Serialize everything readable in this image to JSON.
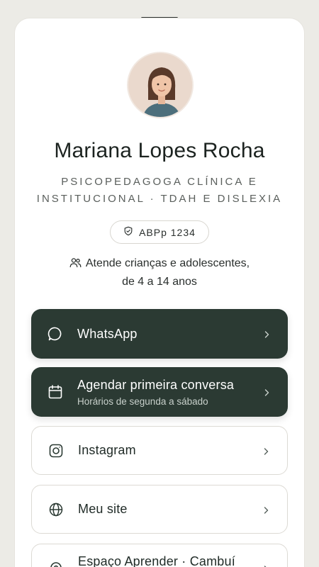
{
  "profile": {
    "name": "Mariana Lopes Rocha",
    "subtitle": "PSICOPEDAGOGA CLÍNICA E INSTITUCIONAL · TDAH E DISLEXIA",
    "badge": "ABPp 1234",
    "audience": "Atende crianças e adolescentes, de 4 a 14 anos"
  },
  "links": [
    {
      "label": "WhatsApp",
      "icon": "chat-bubble-icon"
    },
    {
      "label": "Agendar primeira conversa",
      "sub": "Horários de segunda a sábado",
      "icon": "calendar-icon"
    },
    {
      "label": "Instagram",
      "icon": "instagram-icon"
    },
    {
      "label": "Meu site",
      "icon": "globe-icon"
    },
    {
      "label": "Espaço Aprender · Cambuí",
      "icon": "location-pin-icon"
    }
  ],
  "colors": {
    "background": "#ecebe6",
    "card": "#ffffff",
    "primary_button": "#2b3a33",
    "text": "#1f2a26"
  }
}
